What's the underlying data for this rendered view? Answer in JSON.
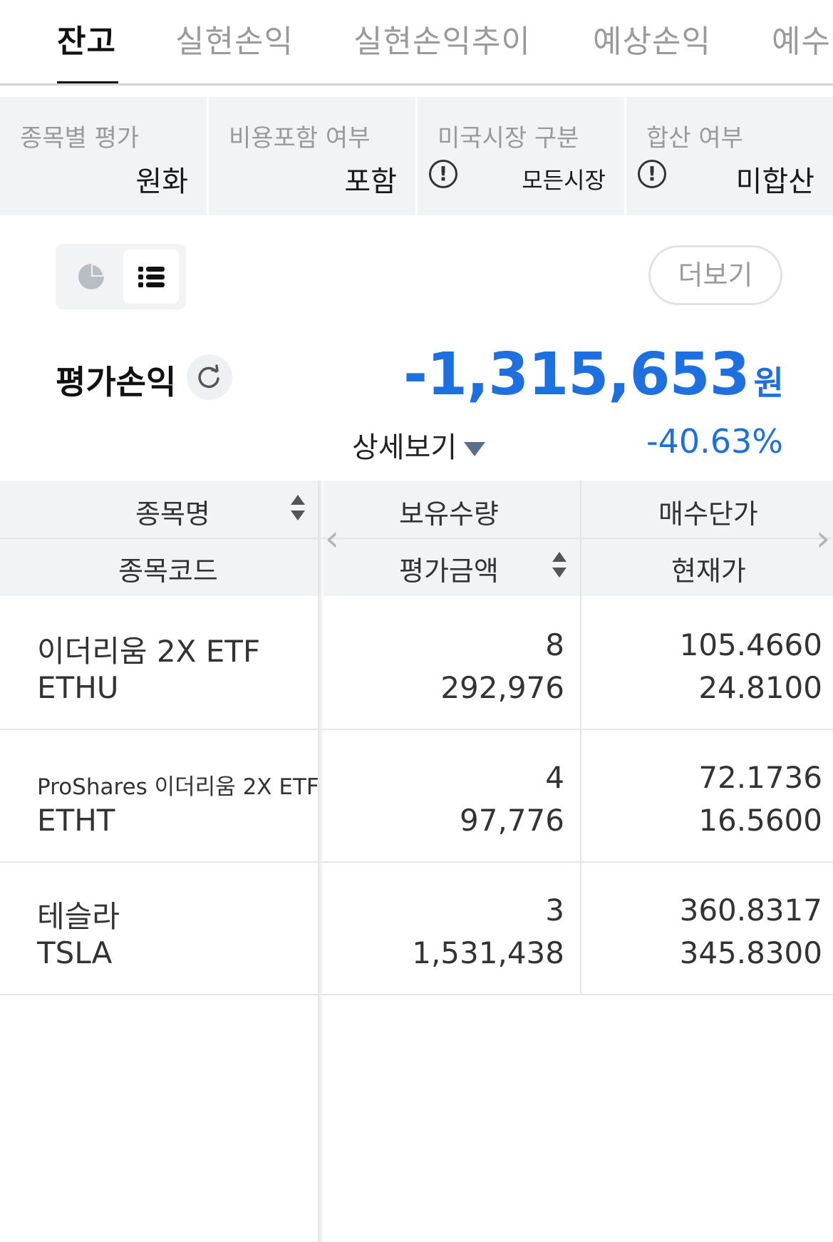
{
  "tabs": [
    {
      "label": "잔고",
      "active": true
    },
    {
      "label": "실현손익",
      "active": false
    },
    {
      "label": "실현손익추이",
      "active": false
    },
    {
      "label": "예상손익",
      "active": false
    },
    {
      "label": "예수",
      "active": false
    }
  ],
  "filters": [
    {
      "label": "종목별 평가",
      "value": "원화"
    },
    {
      "label": "비용포함 여부",
      "value": "포함"
    },
    {
      "label": "미국시장 구분",
      "value": "모든시장"
    },
    {
      "label": "합산 여부",
      "value": "미합산"
    }
  ],
  "toolbar": {
    "more_label": "더보기"
  },
  "summary": {
    "label": "평가손익",
    "amount": "-1,315,653",
    "unit": "원",
    "detail_label": "상세보기",
    "rate": "-40.63%"
  },
  "table": {
    "headers": {
      "col1_top": "종목명",
      "col1_bottom": "종목코드",
      "col2_top": "보유수량",
      "col2_bottom": "평가금액",
      "col3_top": "매수단가",
      "col3_bottom": "현재가"
    },
    "rows": [
      {
        "name": "이더리움 2X ETF",
        "code": "ETHU",
        "qty": "8",
        "eval": "292,976",
        "buy_price": "105.4660",
        "cur_price": "24.8100"
      },
      {
        "name": "ProShares 이더리움 2X ETF",
        "code": "ETHT",
        "qty": "4",
        "eval": "97,776",
        "buy_price": "72.1736",
        "cur_price": "16.5600"
      },
      {
        "name": "테슬라",
        "code": "TSLA",
        "qty": "3",
        "eval": "1,531,438",
        "buy_price": "360.8317",
        "cur_price": "345.8300"
      }
    ]
  },
  "colors": {
    "accent": "#1e6fe0",
    "header_bg": "#f1f3f5"
  },
  "icons": [
    "pie-chart-icon",
    "list-icon",
    "info-icon",
    "refresh-icon",
    "caret-down-icon",
    "sort-icon",
    "chevron-left-icon",
    "chevron-right-icon"
  ]
}
